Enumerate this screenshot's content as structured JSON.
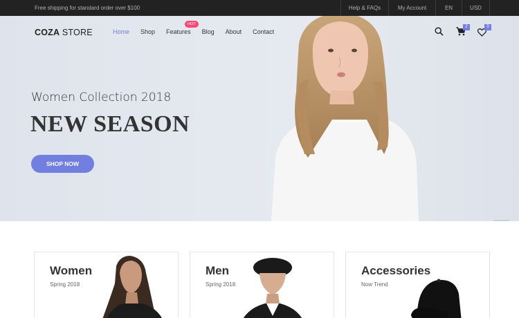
{
  "topbar": {
    "shipping_text": "Free shipping for standard order over $100",
    "links": [
      "Help & FAQs",
      "My Account",
      "EN",
      "USD"
    ]
  },
  "header": {
    "logo_bold": "COZA",
    "logo_light": " STORE",
    "nav": [
      {
        "label": "Home",
        "active": true
      },
      {
        "label": "Shop"
      },
      {
        "label": "Features",
        "badge": "HOT"
      },
      {
        "label": "Blog"
      },
      {
        "label": "About"
      },
      {
        "label": "Contact"
      }
    ],
    "icons": [
      "search-icon",
      "cart-icon",
      "heart-icon"
    ],
    "cart_count": "2",
    "wishlist_count": "0"
  },
  "hero": {
    "subtitle": "Women Collection 2018",
    "title": "NEW SEASON",
    "button": "SHOP NOW"
  },
  "banners": [
    {
      "title": "Women",
      "subtitle": "Spring 2018"
    },
    {
      "title": "Men",
      "subtitle": "Spring 2018"
    },
    {
      "title": "Accessories",
      "subtitle": "Now Trend"
    }
  ],
  "colors": {
    "accent": "#717fe0",
    "hot": "#f74877",
    "topbar": "#222222",
    "hero_bg": "#e3e8ef"
  }
}
